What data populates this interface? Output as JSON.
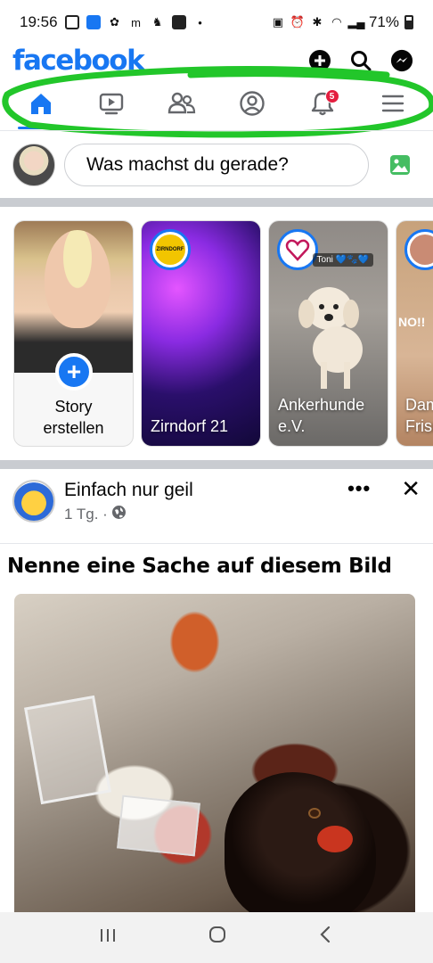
{
  "status_bar": {
    "time": "19:56",
    "battery": "71%"
  },
  "header": {
    "logo": "facebook",
    "icons": [
      "plus-icon",
      "search-icon",
      "messenger-icon"
    ]
  },
  "nav": {
    "tabs": [
      {
        "name": "home",
        "icon": "home-icon",
        "active": true
      },
      {
        "name": "watch",
        "icon": "video-icon"
      },
      {
        "name": "friends",
        "icon": "friends-icon"
      },
      {
        "name": "profile",
        "icon": "profile-icon"
      },
      {
        "name": "notifications",
        "icon": "bell-icon",
        "badge": "5"
      },
      {
        "name": "menu",
        "icon": "menu-icon"
      }
    ]
  },
  "composer": {
    "placeholder": "Was machst du gerade?"
  },
  "stories": {
    "create_label_line1": "Story",
    "create_label_line2": "erstellen",
    "items": [
      {
        "name": "Zirndorf 21",
        "avatar_text": "ZIRNDORF"
      },
      {
        "name_line1": "Ankerhunde",
        "name_line2": "e.V.",
        "tag": "Toni 💙🐾💙"
      },
      {
        "name_line1": "Dam",
        "name_line2": "Frisu",
        "tag": "NO!!"
      }
    ]
  },
  "post": {
    "author": "Einfach nur geil",
    "time": "1 Tg. ·",
    "caption": "Nenne eine Sache auf diesem Bild"
  },
  "colors": {
    "brand": "#1877f2",
    "badge": "#e41e3f",
    "annotation": "#22c62a"
  }
}
